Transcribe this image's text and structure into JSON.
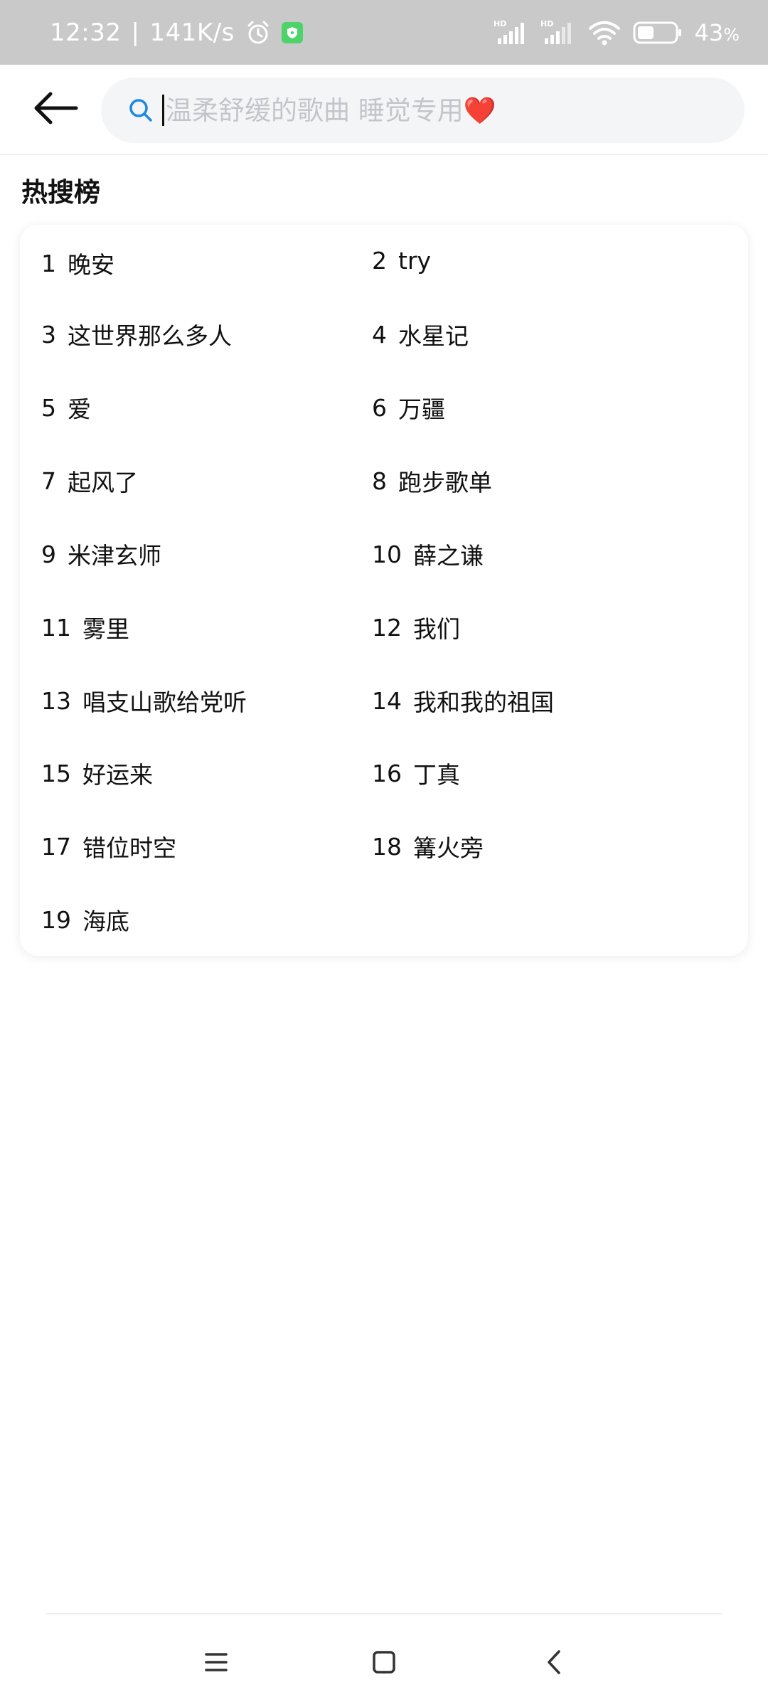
{
  "status_bar": {
    "time": "12:32",
    "separator": "|",
    "speed": "141K/s",
    "battery": "43",
    "battery_unit": "%",
    "icons": [
      "alarm-icon",
      "shield-icon",
      "signal-hd-icon",
      "signal-hd-icon",
      "wifi-icon",
      "battery-icon"
    ]
  },
  "search": {
    "placeholder": "温柔舒缓的歌曲 睡觉专用❤️"
  },
  "hot_search": {
    "title": "热搜榜",
    "items": [
      {
        "rank": "1",
        "label": "晚安"
      },
      {
        "rank": "2",
        "label": "try"
      },
      {
        "rank": "3",
        "label": "这世界那么多人"
      },
      {
        "rank": "4",
        "label": "水星记"
      },
      {
        "rank": "5",
        "label": "爱"
      },
      {
        "rank": "6",
        "label": "万疆"
      },
      {
        "rank": "7",
        "label": "起风了"
      },
      {
        "rank": "8",
        "label": "跑步歌单"
      },
      {
        "rank": "9",
        "label": "米津玄师"
      },
      {
        "rank": "10",
        "label": "薛之谦"
      },
      {
        "rank": "11",
        "label": "雾里"
      },
      {
        "rank": "12",
        "label": "我们"
      },
      {
        "rank": "13",
        "label": "唱支山歌给党听"
      },
      {
        "rank": "14",
        "label": "我和我的祖国"
      },
      {
        "rank": "15",
        "label": "好运来"
      },
      {
        "rank": "16",
        "label": "丁真"
      },
      {
        "rank": "17",
        "label": "错位时空"
      },
      {
        "rank": "18",
        "label": "篝火旁"
      },
      {
        "rank": "19",
        "label": "海底"
      }
    ]
  },
  "nav": {
    "buttons": [
      "menu-icon",
      "home-icon",
      "back-icon"
    ]
  }
}
